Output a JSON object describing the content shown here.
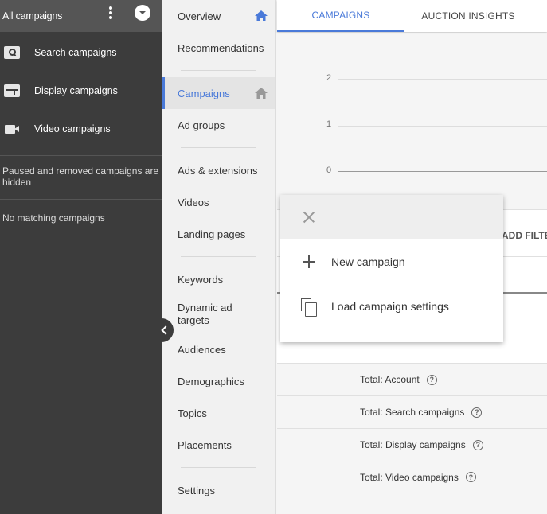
{
  "sidebar": {
    "header_title": "All campaigns",
    "campaign_types": [
      {
        "label": "Search campaigns",
        "icon": "search-icon"
      },
      {
        "label": "Display campaigns",
        "icon": "display-icon"
      },
      {
        "label": "Video campaigns",
        "icon": "video-icon"
      }
    ],
    "note": "Paused and removed campaigns are hidden",
    "empty_message": "No matching campaigns"
  },
  "nav": {
    "items": [
      {
        "label": "Overview",
        "icon": "home-icon"
      },
      {
        "label": "Recommendations"
      },
      {
        "label": "Campaigns",
        "icon": "home-icon",
        "active": true
      },
      {
        "label": "Ad groups"
      },
      {
        "label": "Ads & extensions"
      },
      {
        "label": "Videos"
      },
      {
        "label": "Landing pages"
      },
      {
        "label": "Keywords"
      },
      {
        "label": "Dynamic ad targets"
      },
      {
        "label": "Audiences"
      },
      {
        "label": "Demographics"
      },
      {
        "label": "Topics"
      },
      {
        "label": "Placements"
      },
      {
        "label": "Settings"
      }
    ]
  },
  "tabs": [
    {
      "label": "CAMPAIGNS",
      "active": true
    },
    {
      "label": "AUCTION INSIGHTS"
    }
  ],
  "chart": {
    "y_ticks": [
      "2",
      "1",
      "0"
    ]
  },
  "toolbar": {
    "add_filter_label": "ADD FILTER"
  },
  "totals": [
    {
      "label": "Total: Account"
    },
    {
      "label": "Total: Search campaigns"
    },
    {
      "label": "Total: Display campaigns"
    },
    {
      "label": "Total: Video campaigns"
    }
  ],
  "popup": {
    "items": [
      {
        "label": "New campaign",
        "icon": "plus-icon"
      },
      {
        "label": "Load campaign settings",
        "icon": "copy-icon"
      }
    ]
  },
  "colors": {
    "accent": "#4a7ad9",
    "sidebar_bg": "#3c3c3c",
    "sidebar_header_bg": "#555555"
  }
}
